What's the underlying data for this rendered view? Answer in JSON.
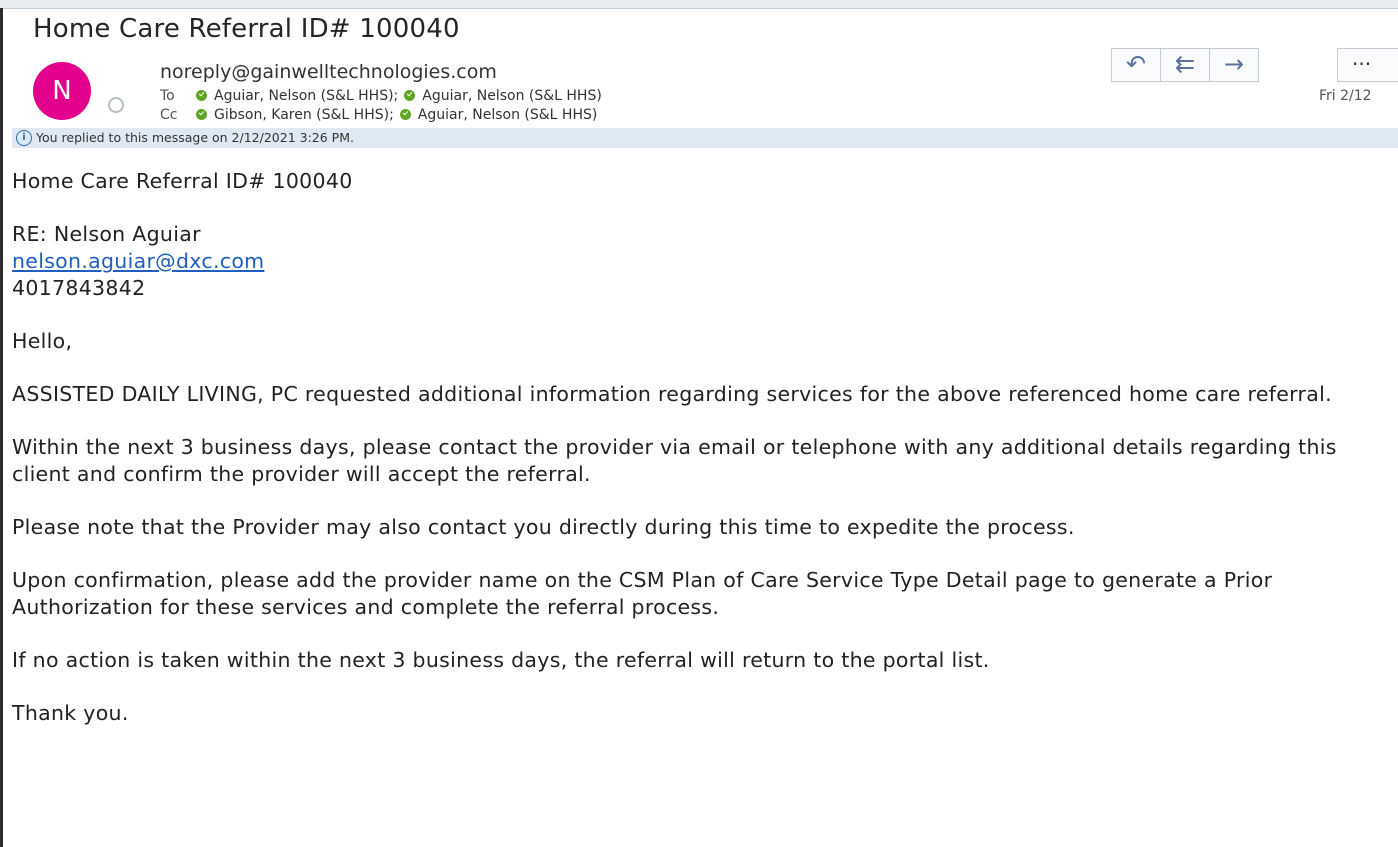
{
  "header": {
    "subject": "Home Care Referral ID# 100040",
    "avatar_initial": "N",
    "sender": "noreply@gainwelltechnologies.com",
    "to_label": "To",
    "to_recipients": [
      "Aguiar, Nelson (S&L HHS);",
      "Aguiar, Nelson (S&L HHS)"
    ],
    "cc_label": "Cc",
    "cc_recipients": [
      "Gibson, Karen (S&L HHS);",
      "Aguiar, Nelson (S&L HHS)"
    ],
    "date": "Fri 2/12",
    "info_text": "You replied to this message on 2/12/2021 3:26 PM.",
    "avatar_color": "#e3008c"
  },
  "actions": {
    "reply_icon": "reply-icon",
    "reply_all_icon": "reply-all-icon",
    "forward_icon": "forward-icon",
    "more_icon": "more-icon"
  },
  "body": {
    "title_line": "Home Care Referral ID# 100040",
    "re_line": "RE: Nelson Aguiar",
    "email_link": "nelson.aguiar@dxc.com",
    "phone": "4017843842",
    "greeting": "Hello,",
    "para1": "ASSISTED DAILY LIVING, PC requested additional information regarding services for the above referenced home care referral.",
    "para2": "Within the next 3 business days, please contact the provider via email or telephone with any additional details regarding this client and confirm the provider will accept the referral.",
    "para3": "Please note that the Provider may also contact you directly during this time to expedite the process.",
    "para4": "Upon confirmation, please add the provider name on the CSM Plan of Care Service Type Detail page to generate a Prior Authorization for these services and complete the referral process.",
    "para5": "If no action is taken within the next 3 business days, the referral will return to the portal list.",
    "closing": "Thank you."
  }
}
